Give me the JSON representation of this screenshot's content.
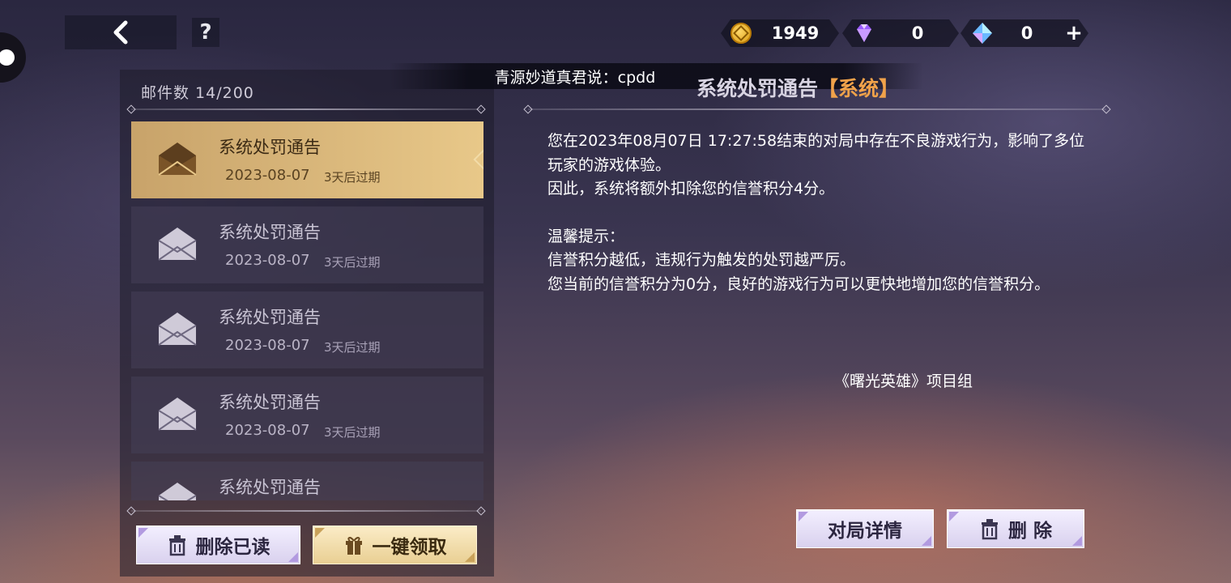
{
  "header": {
    "currencies": [
      {
        "name": "gold-coin",
        "value": "1949"
      },
      {
        "name": "purple-gem",
        "value": "0"
      },
      {
        "name": "blue-gem",
        "value": "0"
      }
    ],
    "help_label": "?",
    "add_label": "+"
  },
  "broadcast": "青源妙道真君说：cpdd",
  "mailbox": {
    "count_label": "邮件数  14/200",
    "items": [
      {
        "title": "系统处罚通告",
        "date": "2023-08-07",
        "expiry": "3天后过期",
        "selected": true
      },
      {
        "title": "系统处罚通告",
        "date": "2023-08-07",
        "expiry": "3天后过期"
      },
      {
        "title": "系统处罚通告",
        "date": "2023-08-07",
        "expiry": "3天后过期"
      },
      {
        "title": "系统处罚通告",
        "date": "2023-08-07",
        "expiry": "3天后过期"
      },
      {
        "title": "系统处罚通告",
        "date": "",
        "expiry": ""
      }
    ],
    "delete_read_label": "删除已读",
    "claim_all_label": "一键领取"
  },
  "detail": {
    "title": "系统处罚通告",
    "tag": "【系统】",
    "paragraphs": [
      "您在2023年08月07日 17:27:58结束的对局中存在不良游戏行为，影响了多位玩家的游戏体验。",
      "因此，系统将额外扣除您的信誉积分4分。",
      "温馨提示：",
      "信誉积分越低，违规行为触发的处罚越严厉。",
      "您当前的信誉积分为0分，良好的游戏行为可以更快地增加您的信誉积分。"
    ],
    "signature": "《曙光英雄》项目组",
    "match_details_label": "对局详情",
    "delete_label": "删 除"
  },
  "colors": {
    "accent_gold": "#e8c889",
    "tag_orange": "#f0a24a",
    "button_light": "#e6dff5"
  }
}
